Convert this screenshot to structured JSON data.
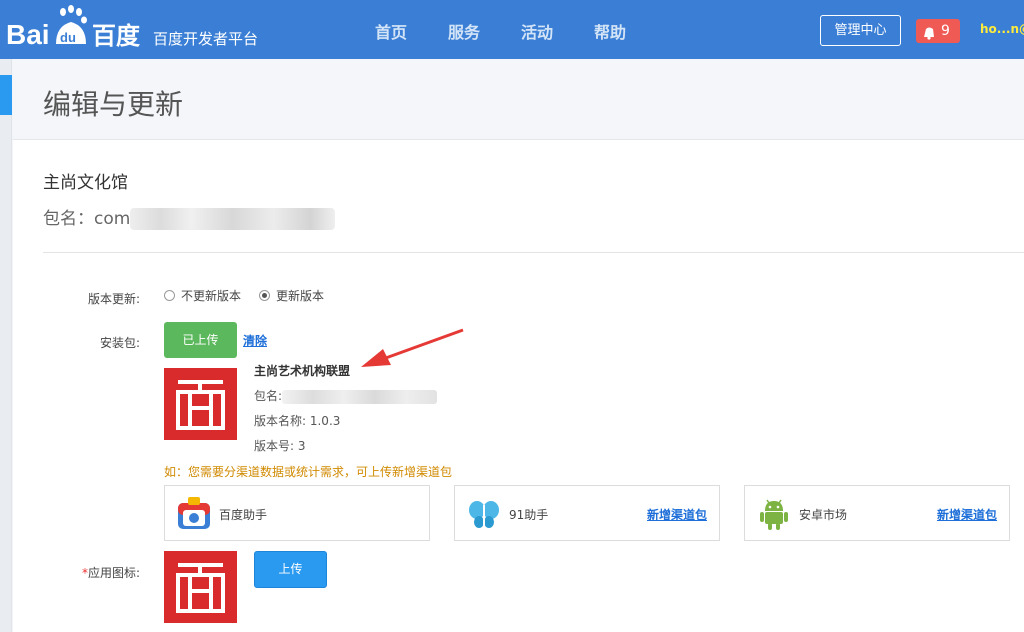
{
  "header": {
    "logo_text": "Bai du 百度",
    "platform_name": "百度开发者平台",
    "nav": [
      "首页",
      "服务",
      "活动",
      "帮助"
    ],
    "mgmt_button": "管理中心",
    "message_count": "9",
    "user_name": "ho...n@",
    "brand_color": "#3a7fd5"
  },
  "page": {
    "title": "编辑与更新"
  },
  "app": {
    "name": "主尚文化馆",
    "package_label": "包名：com"
  },
  "form": {
    "version_update_label": "版本更新:",
    "radio_no_update": "不更新版本",
    "radio_update": "更新版本",
    "selected_option": "更新版本",
    "install_pkg_label": "安装包:",
    "uploaded_button": "已上传",
    "clear_link": "清除",
    "pkg_info_title": "主尚艺术机构联盟",
    "pkg_info_name_label": "包名:",
    "version_name": "版本名称: 1.0.3",
    "version_code": "版本号: 3",
    "channel_hint": "如：您需要分渠道数据或统计需求，可上传新增渠道包",
    "app_icon_required": "*",
    "app_icon_label": "应用图标:",
    "upload_button": "上传"
  },
  "markets": [
    {
      "name": "百度助手",
      "icon": "baidu-helper-icon",
      "add_label": ""
    },
    {
      "name": "91助手",
      "icon": "butterfly-icon",
      "add_label": "新增渠道包"
    },
    {
      "name": "安卓市场",
      "icon": "android-icon",
      "add_label": "新增渠道包"
    }
  ]
}
